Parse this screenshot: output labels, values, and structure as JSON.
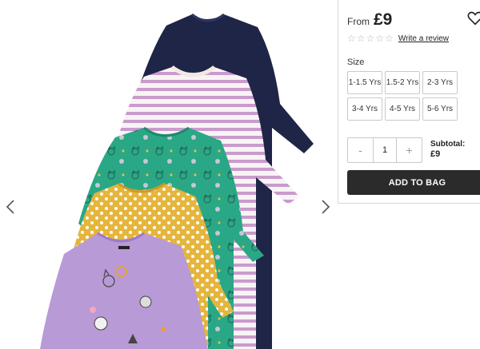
{
  "price": {
    "from_label": "From",
    "value": "£9"
  },
  "rating": {
    "stars_filled": 0,
    "stars_total": 5,
    "review_link": "Write a review"
  },
  "size": {
    "label": "Size",
    "options": [
      "1-1.5 Yrs",
      "1.5-2 Yrs",
      "2-3 Yrs",
      "3-4 Yrs",
      "4-5 Yrs",
      "5-6 Yrs"
    ]
  },
  "quantity": {
    "minus": "-",
    "value": "1",
    "plus": "+"
  },
  "subtotal": {
    "label": "Subtotal:",
    "value": "£9"
  },
  "add_to_bag": "ADD TO BAG",
  "icons": {
    "wishlist": "heart-outline-icon",
    "prev": "chevron-left-icon",
    "next": "chevron-right-icon",
    "star": "star-outline-icon"
  },
  "colors": {
    "navy": "#1f2547",
    "stripe_pink": "#c99bcb",
    "green": "#2aa886",
    "mustard": "#e5b53c",
    "lilac": "#b79ad6",
    "button_dark": "#2b2b2b"
  }
}
